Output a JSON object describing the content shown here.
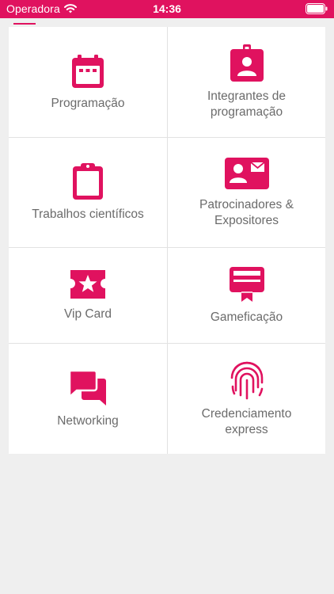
{
  "status_bar": {
    "carrier": "Operadora",
    "time": "14:36",
    "wifi_icon": "wifi-icon",
    "battery_icon": "battery-icon",
    "background_color": "#e0125f"
  },
  "accent_color": "#e0125f",
  "menu": {
    "items": [
      {
        "label": "Programação",
        "icon": "calendar-icon"
      },
      {
        "label": "Integrantes de\nprogramação",
        "icon": "badge-icon"
      },
      {
        "label": "Trabalhos científicos",
        "icon": "clipboard-icon"
      },
      {
        "label": "Patrocinadores &\nExpositores",
        "icon": "contact-card-icon"
      },
      {
        "label": "Vip Card",
        "icon": "ticket-star-icon"
      },
      {
        "label": "Gameficação",
        "icon": "card-ribbon-icon"
      },
      {
        "label": "Networking",
        "icon": "chat-bubbles-icon"
      },
      {
        "label": "Credenciamento\nexpress",
        "icon": "fingerprint-icon"
      }
    ]
  }
}
